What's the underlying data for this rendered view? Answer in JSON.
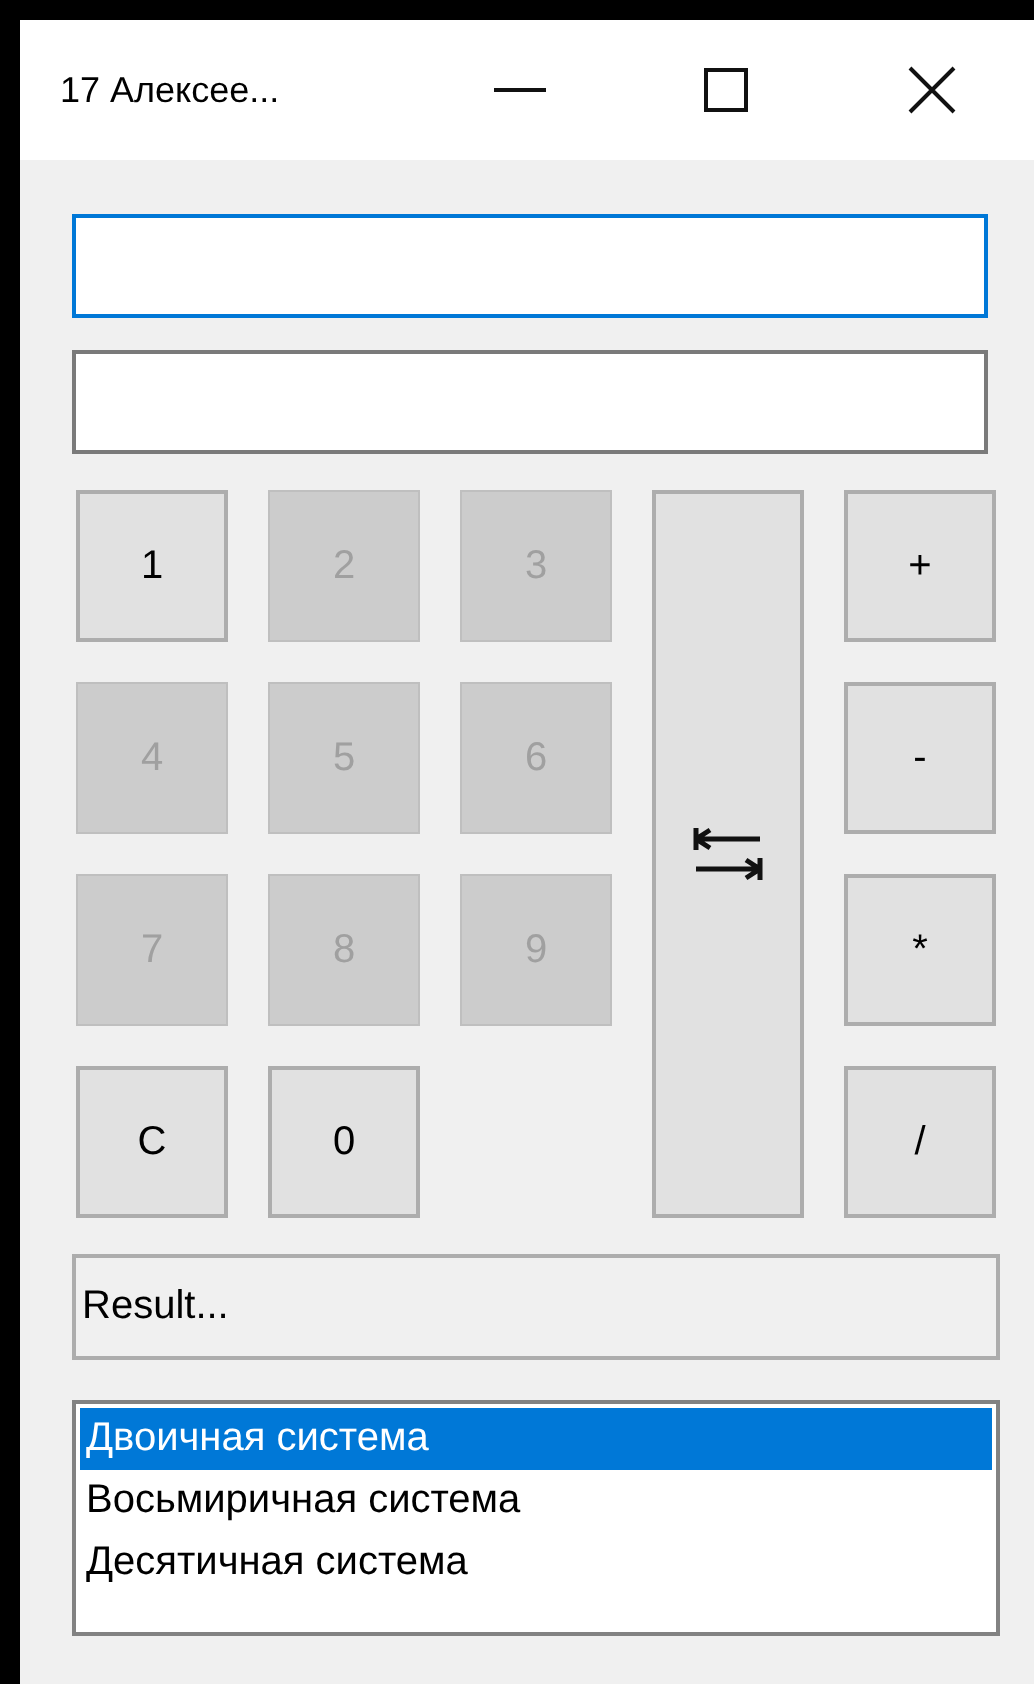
{
  "window": {
    "title": "17 Алексее..."
  },
  "inputs": [
    {
      "focused": true
    },
    {
      "focused": false
    }
  ],
  "keypad": {
    "keys": [
      {
        "label": "1",
        "disabled": false
      },
      {
        "label": "2",
        "disabled": true
      },
      {
        "label": "3",
        "disabled": true
      },
      {
        "label": "4",
        "disabled": true
      },
      {
        "label": "5",
        "disabled": true
      },
      {
        "label": "6",
        "disabled": true
      },
      {
        "label": "7",
        "disabled": true
      },
      {
        "label": "8",
        "disabled": true
      },
      {
        "label": "9",
        "disabled": true
      },
      {
        "label": "C",
        "disabled": false
      },
      {
        "label": "0",
        "disabled": false
      }
    ],
    "operators": [
      "+",
      "-",
      "*",
      "/"
    ]
  },
  "result_field": {
    "value": "Result..."
  },
  "number_systems": [
    {
      "label": "Двоичная система",
      "selected": true
    },
    {
      "label": "Восьмиричная система",
      "selected": false
    },
    {
      "label": "Десятичная система",
      "selected": false
    }
  ]
}
